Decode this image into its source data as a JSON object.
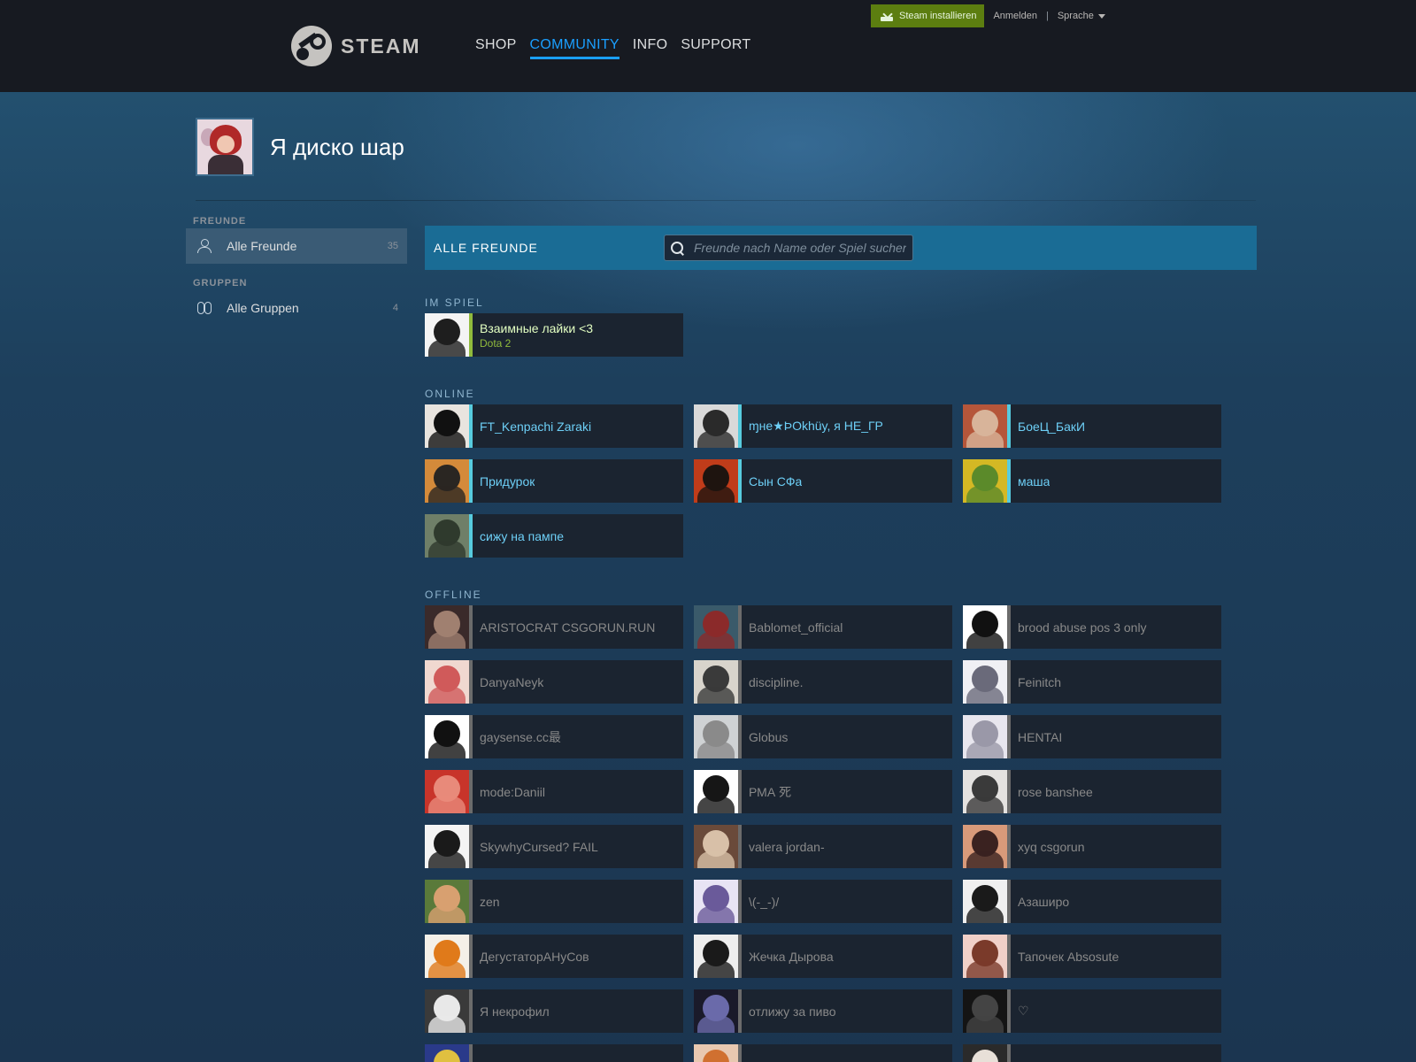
{
  "header": {
    "logo_text": "STEAM",
    "nav": [
      "SHOP",
      "COMMUNITY",
      "INFO",
      "SUPPORT"
    ],
    "active_nav": "COMMUNITY",
    "install_label": "Steam installieren",
    "login_label": "Anmelden",
    "separator": "|",
    "language_label": "Sprache"
  },
  "profile": {
    "name": "Я диско шар"
  },
  "sidebar": {
    "friends_section": "FREUNDE",
    "all_friends_label": "Alle Freunde",
    "all_friends_count": "35",
    "groups_section": "GRUPPEN",
    "all_groups_label": "Alle Gruppen",
    "all_groups_count": "4"
  },
  "main": {
    "title": "ALLE FREUNDE",
    "search_placeholder": "Freunde nach Name oder Spiel suchen",
    "ingame_title": "IM SPIEL",
    "online_title": "ONLINE",
    "offline_title": "OFFLINE"
  },
  "colors": {
    "accent": "#1a9fff",
    "ingame": "#90ba3c",
    "online": "#57cbde",
    "offline": "#6b6b6b"
  },
  "friends": {
    "ingame": [
      {
        "name": "Взаимные лайки <3",
        "game": "Dota 2",
        "avatar": [
          "#f4f4f4",
          "#1e1e1e"
        ]
      }
    ],
    "online": [
      {
        "name": "FT_Kenpachi Zaraki",
        "avatar": [
          "#e8e4df",
          "#111111"
        ]
      },
      {
        "name": "ɱнe★ÞOkhüy, я НЕ_ГР",
        "avatar": [
          "#d9d9d9",
          "#2a2a2a"
        ]
      },
      {
        "name": "БоеЦ_БакИ",
        "avatar": [
          "#b5563a",
          "#d8b49a"
        ]
      },
      {
        "name": "Придурок",
        "avatar": [
          "#d48a3a",
          "#2a2622"
        ]
      },
      {
        "name": "Сын СФа",
        "avatar": [
          "#c03c1a",
          "#1e140f"
        ]
      },
      {
        "name": "маша",
        "avatar": [
          "#d4b824",
          "#5b8a2a"
        ]
      },
      {
        "name": "сижу на пампе",
        "avatar": [
          "#6f7f68",
          "#2f3a2d"
        ]
      }
    ],
    "offline": [
      {
        "name": "ARISTOCRAT CSGORUN.RUN",
        "avatar": [
          "#3a2a2a",
          "#a08070"
        ]
      },
      {
        "name": "Bablomet_official",
        "avatar": [
          "#3a5a6a",
          "#8b2a2a"
        ]
      },
      {
        "name": "brood abuse pos 3 only",
        "avatar": [
          "#ffffff",
          "#111111"
        ]
      },
      {
        "name": "DanyaNeyk",
        "avatar": [
          "#f0d8d0",
          "#d05a5a"
        ]
      },
      {
        "name": "discipline.",
        "avatar": [
          "#d8d4cc",
          "#3a3a3a"
        ]
      },
      {
        "name": "Feinitch",
        "avatar": [
          "#f0f0f4",
          "#6a6a7a"
        ]
      },
      {
        "name": "gaysense.cc最",
        "avatar": [
          "#ffffff",
          "#111111"
        ]
      },
      {
        "name": "Globus",
        "avatar": [
          "#cfd2d4",
          "#8a8a8a"
        ]
      },
      {
        "name": "HENTAI",
        "avatar": [
          "#e8e6ee",
          "#9a98a8"
        ]
      },
      {
        "name": "mode:Daniil",
        "avatar": [
          "#c8342a",
          "#e88a7a"
        ]
      },
      {
        "name": "РМА 死",
        "avatar": [
          "#ffffff",
          "#161616"
        ]
      },
      {
        "name": "rose banshee",
        "avatar": [
          "#e4e2e0",
          "#3a3a3a"
        ]
      },
      {
        "name": "SkywhyCursed? FAIL",
        "avatar": [
          "#f4f4f4",
          "#1a1a1a"
        ]
      },
      {
        "name": "valera jordan-",
        "avatar": [
          "#6a4a3a",
          "#d8c0a8"
        ]
      },
      {
        "name": "xyq csgorun",
        "avatar": [
          "#d89a7a",
          "#3a2220"
        ]
      },
      {
        "name": "zen",
        "avatar": [
          "#5a7a3a",
          "#d8a070"
        ]
      },
      {
        "name": "\\(-_-)/",
        "avatar": [
          "#e8e4f4",
          "#6a5a9a"
        ]
      },
      {
        "name": "Азаширо",
        "avatar": [
          "#f0f0f0",
          "#1a1a1a"
        ]
      },
      {
        "name": "ДегустаторАНуСов",
        "avatar": [
          "#f4f0e8",
          "#e07a1a"
        ]
      },
      {
        "name": "Жечка Дырова",
        "avatar": [
          "#eeeeee",
          "#1a1a1a"
        ]
      },
      {
        "name": "Тапочек Absosute",
        "avatar": [
          "#f0d0c8",
          "#7a3a2a"
        ]
      },
      {
        "name": "Я некрофил",
        "avatar": [
          "#3a3a3a",
          "#e8e8e8"
        ]
      },
      {
        "name": "отлижу за пиво",
        "avatar": [
          "#1a1a2a",
          "#6a6aaa"
        ]
      },
      {
        "name": "♡",
        "avatar": [
          "#141414",
          "#444444"
        ]
      },
      {
        "name": "",
        "avatar": [
          "#2a3a8a",
          "#e0c040"
        ]
      },
      {
        "name": "",
        "avatar": [
          "#e8c8b0",
          "#d07030"
        ]
      },
      {
        "name": "",
        "avatar": [
          "#2a2a2a",
          "#e8e0d8"
        ]
      }
    ]
  }
}
